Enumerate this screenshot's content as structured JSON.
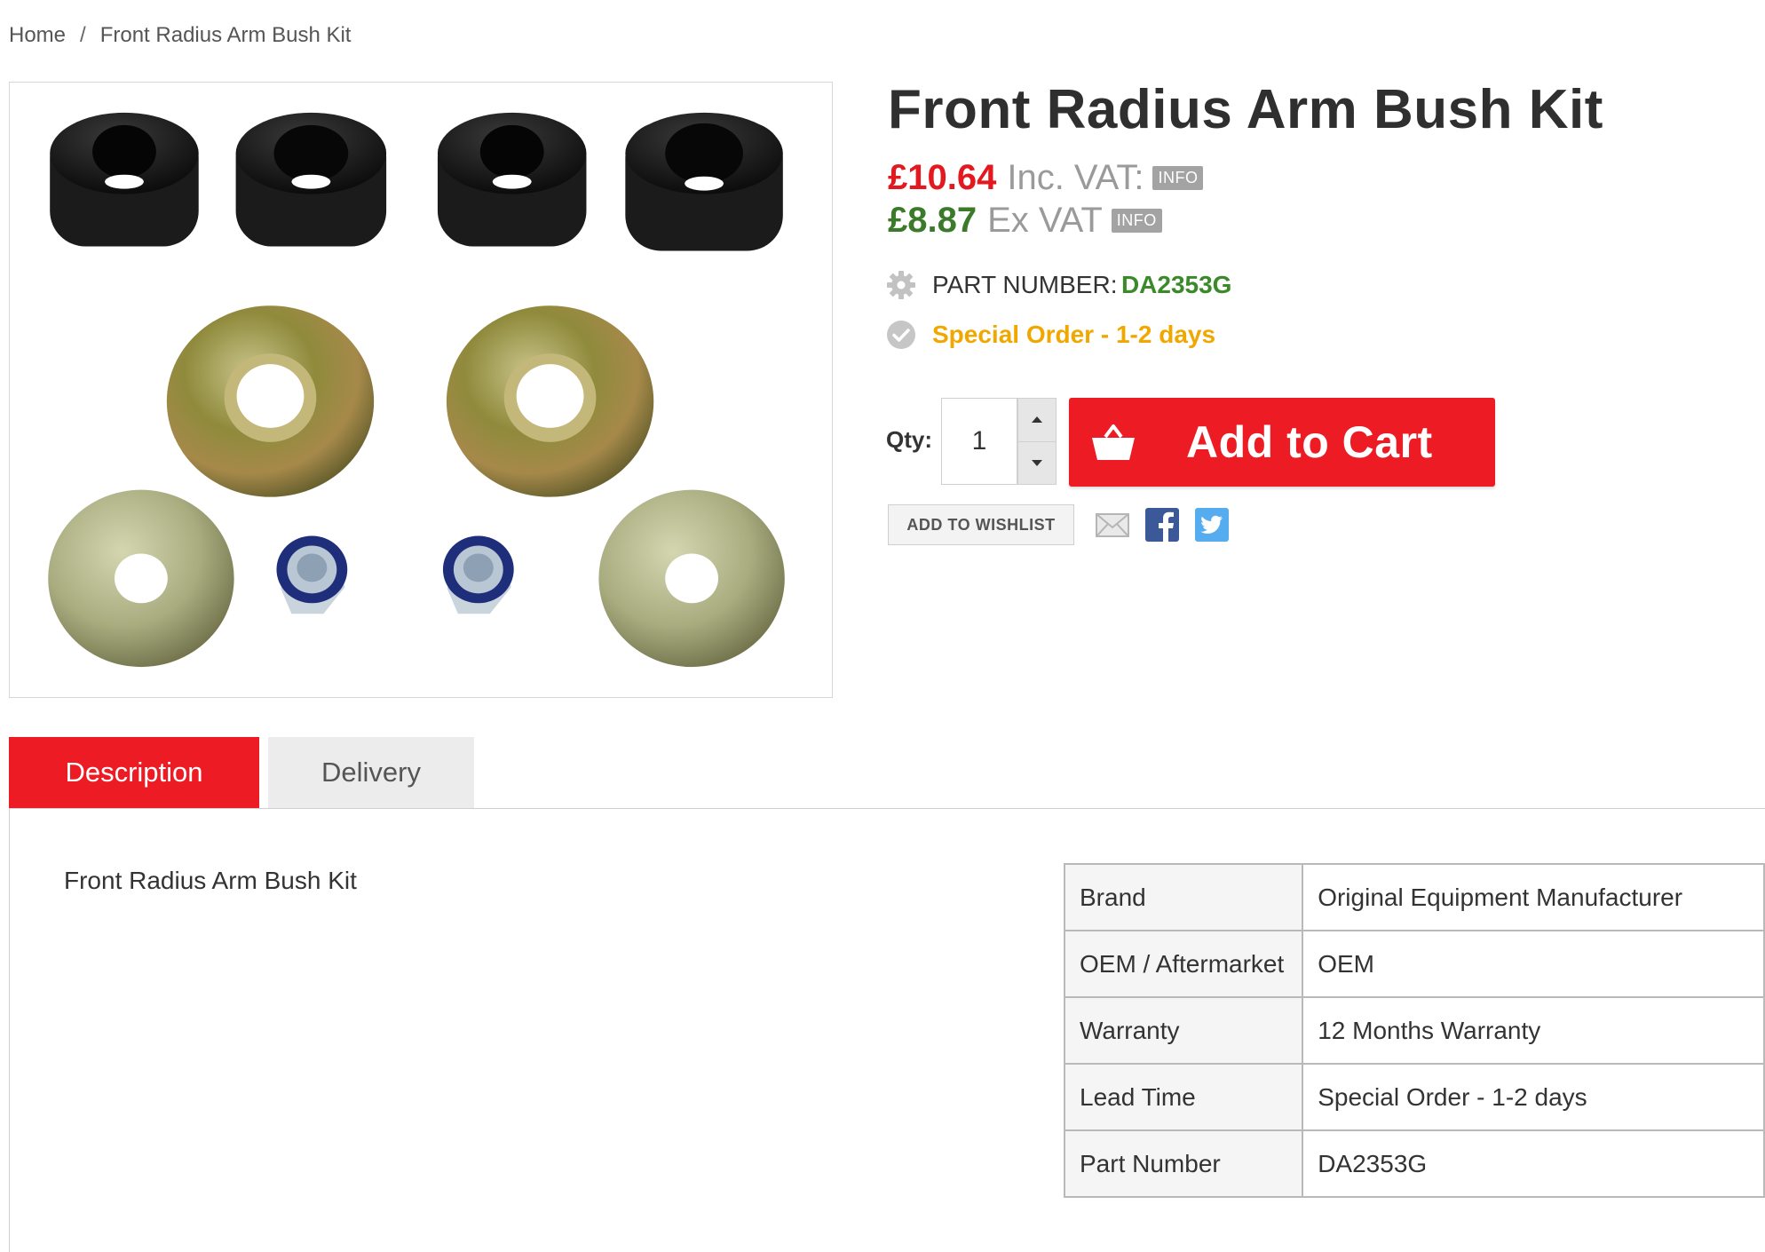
{
  "breadcrumb": {
    "home": "Home",
    "separator": "/",
    "current": "Front Radius Arm Bush Kit"
  },
  "product": {
    "title": "Front Radius Arm Bush Kit",
    "price_inc": "£10.64",
    "inc_label": "Inc. VAT:",
    "price_ex": "£8.87",
    "ex_label": "Ex VAT",
    "info_badge": "INFO",
    "part_label": "PART NUMBER:",
    "part_number": "DA2353G",
    "stock": "Special Order - 1-2 days"
  },
  "purchase": {
    "qty_label": "Qty:",
    "qty_value": "1",
    "add_to_cart": "Add to Cart",
    "wishlist": "ADD TO WISHLIST"
  },
  "share": {
    "email_icon": "email-icon",
    "facebook_icon": "facebook-icon",
    "twitter_icon": "twitter-icon"
  },
  "tabs": [
    {
      "label": "Description"
    },
    {
      "label": "Delivery"
    }
  ],
  "description": {
    "text": "Front Radius Arm Bush Kit"
  },
  "specs": [
    {
      "key": "Brand",
      "value": "Original Equipment Manufacturer"
    },
    {
      "key": "OEM / Aftermarket",
      "value": "OEM"
    },
    {
      "key": "Warranty",
      "value": "12 Months Warranty"
    },
    {
      "key": "Lead Time",
      "value": "Special Order - 1-2 days"
    },
    {
      "key": "Part Number",
      "value": "DA2353G"
    }
  ],
  "colors": {
    "accent_red": "#ed1c24",
    "price_red": "#e3191f",
    "price_green": "#3a7a2a",
    "part_green": "#3a8a2a",
    "stock_amber": "#f0a800",
    "facebook_blue": "#3b5998",
    "twitter_blue": "#55acee"
  }
}
